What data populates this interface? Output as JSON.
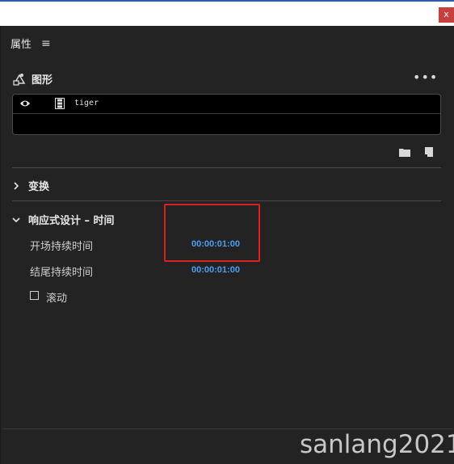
{
  "window": {
    "close_label": "x"
  },
  "panel": {
    "title": "属性",
    "menu_glyph": "≡",
    "graphics_section": {
      "title": "图形",
      "more_glyph": "•••",
      "layers": [
        {
          "name": "tiger"
        }
      ]
    },
    "transform_section": {
      "title": "变换"
    },
    "responsive_section": {
      "title": "响应式设计 – 时间",
      "properties": [
        {
          "label": "开场持续时间",
          "value": "00:00:01:00"
        },
        {
          "label": "结尾持续时间",
          "value": "00:00:01:00"
        }
      ],
      "scroll_checkbox": {
        "label": "滚动",
        "checked": false
      }
    }
  },
  "watermark": "sanlang2021",
  "colors": {
    "panel_bg": "#232323",
    "layer_bg": "#000000",
    "time_value": "#4d9ff5",
    "highlight_box": "#e02020",
    "close_button": "#c8403d"
  },
  "icons": [
    "eye-icon",
    "film-icon",
    "folder-icon",
    "new-layer-icon",
    "graphic-pen-icon",
    "chevron-right-icon",
    "chevron-down-icon"
  ]
}
